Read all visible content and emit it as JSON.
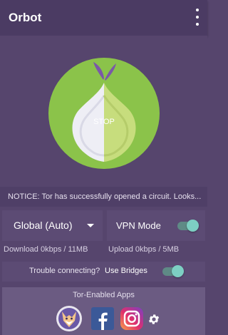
{
  "appbar": {
    "title": "Orbot",
    "menu_icon": "overflow-menu-icon"
  },
  "hero": {
    "button_label": "STOP",
    "colors": {
      "circle": "#8bc34a",
      "onion_right": "#c7dd7d",
      "onion_left": "#eeeef5",
      "leaf": "#7a58a8"
    }
  },
  "notice": {
    "text": "NOTICE: Tor has successfully opened a circuit. Looks..."
  },
  "exit_mode": {
    "selected": "Global (Auto)"
  },
  "vpn": {
    "label": "VPN Mode",
    "enabled": true
  },
  "stats": {
    "download": "Download  0kbps / 11MB",
    "upload": "Upload  0kbps / 5MB"
  },
  "bridges": {
    "question": "Trouble connecting?",
    "link": "Use Bridges",
    "enabled": true
  },
  "apps": {
    "caption": "Tor-Enabled Apps",
    "items": [
      {
        "name": "Orfox",
        "icon": "orfox-icon"
      },
      {
        "name": "Facebook",
        "icon": "facebook-icon"
      },
      {
        "name": "Instagram",
        "icon": "instagram-icon"
      }
    ],
    "settings_icon": "gear-icon"
  }
}
